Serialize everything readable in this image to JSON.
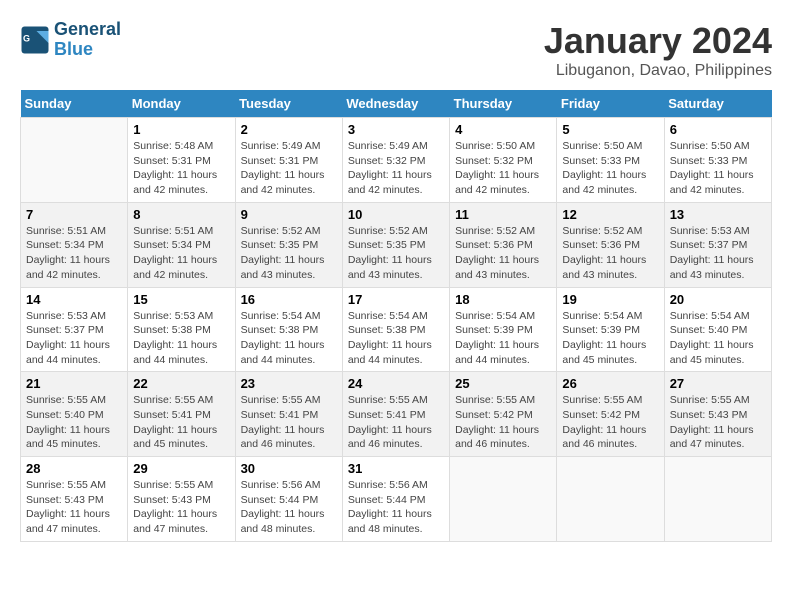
{
  "logo": {
    "line1": "General",
    "line2": "Blue"
  },
  "title": "January 2024",
  "subtitle": "Libuganon, Davao, Philippines",
  "days_of_week": [
    "Sunday",
    "Monday",
    "Tuesday",
    "Wednesday",
    "Thursday",
    "Friday",
    "Saturday"
  ],
  "weeks": [
    [
      {
        "day": "",
        "info": ""
      },
      {
        "day": "1",
        "info": "Sunrise: 5:48 AM\nSunset: 5:31 PM\nDaylight: 11 hours\nand 42 minutes."
      },
      {
        "day": "2",
        "info": "Sunrise: 5:49 AM\nSunset: 5:31 PM\nDaylight: 11 hours\nand 42 minutes."
      },
      {
        "day": "3",
        "info": "Sunrise: 5:49 AM\nSunset: 5:32 PM\nDaylight: 11 hours\nand 42 minutes."
      },
      {
        "day": "4",
        "info": "Sunrise: 5:50 AM\nSunset: 5:32 PM\nDaylight: 11 hours\nand 42 minutes."
      },
      {
        "day": "5",
        "info": "Sunrise: 5:50 AM\nSunset: 5:33 PM\nDaylight: 11 hours\nand 42 minutes."
      },
      {
        "day": "6",
        "info": "Sunrise: 5:50 AM\nSunset: 5:33 PM\nDaylight: 11 hours\nand 42 minutes."
      }
    ],
    [
      {
        "day": "7",
        "info": "Sunrise: 5:51 AM\nSunset: 5:34 PM\nDaylight: 11 hours\nand 42 minutes."
      },
      {
        "day": "8",
        "info": "Sunrise: 5:51 AM\nSunset: 5:34 PM\nDaylight: 11 hours\nand 42 minutes."
      },
      {
        "day": "9",
        "info": "Sunrise: 5:52 AM\nSunset: 5:35 PM\nDaylight: 11 hours\nand 43 minutes."
      },
      {
        "day": "10",
        "info": "Sunrise: 5:52 AM\nSunset: 5:35 PM\nDaylight: 11 hours\nand 43 minutes."
      },
      {
        "day": "11",
        "info": "Sunrise: 5:52 AM\nSunset: 5:36 PM\nDaylight: 11 hours\nand 43 minutes."
      },
      {
        "day": "12",
        "info": "Sunrise: 5:52 AM\nSunset: 5:36 PM\nDaylight: 11 hours\nand 43 minutes."
      },
      {
        "day": "13",
        "info": "Sunrise: 5:53 AM\nSunset: 5:37 PM\nDaylight: 11 hours\nand 43 minutes."
      }
    ],
    [
      {
        "day": "14",
        "info": "Sunrise: 5:53 AM\nSunset: 5:37 PM\nDaylight: 11 hours\nand 44 minutes."
      },
      {
        "day": "15",
        "info": "Sunrise: 5:53 AM\nSunset: 5:38 PM\nDaylight: 11 hours\nand 44 minutes."
      },
      {
        "day": "16",
        "info": "Sunrise: 5:54 AM\nSunset: 5:38 PM\nDaylight: 11 hours\nand 44 minutes."
      },
      {
        "day": "17",
        "info": "Sunrise: 5:54 AM\nSunset: 5:38 PM\nDaylight: 11 hours\nand 44 minutes."
      },
      {
        "day": "18",
        "info": "Sunrise: 5:54 AM\nSunset: 5:39 PM\nDaylight: 11 hours\nand 44 minutes."
      },
      {
        "day": "19",
        "info": "Sunrise: 5:54 AM\nSunset: 5:39 PM\nDaylight: 11 hours\nand 45 minutes."
      },
      {
        "day": "20",
        "info": "Sunrise: 5:54 AM\nSunset: 5:40 PM\nDaylight: 11 hours\nand 45 minutes."
      }
    ],
    [
      {
        "day": "21",
        "info": "Sunrise: 5:55 AM\nSunset: 5:40 PM\nDaylight: 11 hours\nand 45 minutes."
      },
      {
        "day": "22",
        "info": "Sunrise: 5:55 AM\nSunset: 5:41 PM\nDaylight: 11 hours\nand 45 minutes."
      },
      {
        "day": "23",
        "info": "Sunrise: 5:55 AM\nSunset: 5:41 PM\nDaylight: 11 hours\nand 46 minutes."
      },
      {
        "day": "24",
        "info": "Sunrise: 5:55 AM\nSunset: 5:41 PM\nDaylight: 11 hours\nand 46 minutes."
      },
      {
        "day": "25",
        "info": "Sunrise: 5:55 AM\nSunset: 5:42 PM\nDaylight: 11 hours\nand 46 minutes."
      },
      {
        "day": "26",
        "info": "Sunrise: 5:55 AM\nSunset: 5:42 PM\nDaylight: 11 hours\nand 46 minutes."
      },
      {
        "day": "27",
        "info": "Sunrise: 5:55 AM\nSunset: 5:43 PM\nDaylight: 11 hours\nand 47 minutes."
      }
    ],
    [
      {
        "day": "28",
        "info": "Sunrise: 5:55 AM\nSunset: 5:43 PM\nDaylight: 11 hours\nand 47 minutes."
      },
      {
        "day": "29",
        "info": "Sunrise: 5:55 AM\nSunset: 5:43 PM\nDaylight: 11 hours\nand 47 minutes."
      },
      {
        "day": "30",
        "info": "Sunrise: 5:56 AM\nSunset: 5:44 PM\nDaylight: 11 hours\nand 48 minutes."
      },
      {
        "day": "31",
        "info": "Sunrise: 5:56 AM\nSunset: 5:44 PM\nDaylight: 11 hours\nand 48 minutes."
      },
      {
        "day": "",
        "info": ""
      },
      {
        "day": "",
        "info": ""
      },
      {
        "day": "",
        "info": ""
      }
    ]
  ]
}
